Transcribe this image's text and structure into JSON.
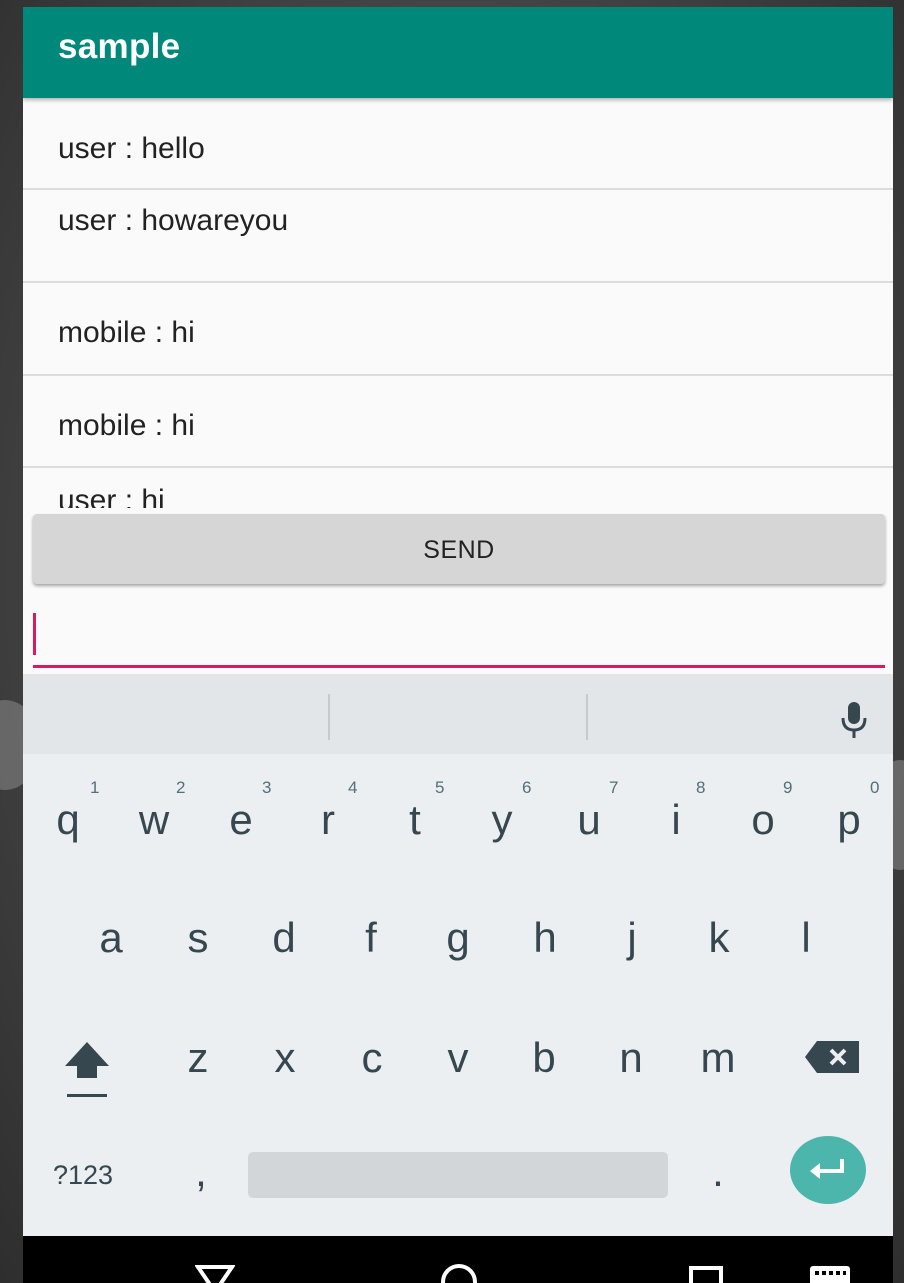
{
  "app": {
    "title": "sample"
  },
  "messages": [
    {
      "text": "user : hello"
    },
    {
      "text": "user : howareyou"
    },
    {
      "text": "mobile : hi"
    },
    {
      "text": "mobile : hi"
    },
    {
      "text": "user : hi"
    }
  ],
  "send_button": {
    "label": "SEND"
  },
  "input": {
    "value": "",
    "placeholder": ""
  },
  "keyboard": {
    "row1": [
      {
        "key": "q",
        "hint": "1"
      },
      {
        "key": "w",
        "hint": "2"
      },
      {
        "key": "e",
        "hint": "3"
      },
      {
        "key": "r",
        "hint": "4"
      },
      {
        "key": "t",
        "hint": "5"
      },
      {
        "key": "y",
        "hint": "6"
      },
      {
        "key": "u",
        "hint": "7"
      },
      {
        "key": "i",
        "hint": "8"
      },
      {
        "key": "o",
        "hint": "9"
      },
      {
        "key": "p",
        "hint": "0"
      }
    ],
    "row2": [
      "a",
      "s",
      "d",
      "f",
      "g",
      "h",
      "j",
      "k",
      "l"
    ],
    "row3": [
      "z",
      "x",
      "c",
      "v",
      "b",
      "n",
      "m"
    ],
    "row4": {
      "symbols": "?123",
      "comma": ",",
      "period": "."
    },
    "icons": {
      "shift": "shift-icon",
      "backspace": "backspace-icon",
      "enter": "enter-icon",
      "mic": "microphone-icon"
    }
  },
  "colors": {
    "toolbar": "#00897b",
    "accent": "#d81b60",
    "enter_key": "#4db6ac"
  }
}
